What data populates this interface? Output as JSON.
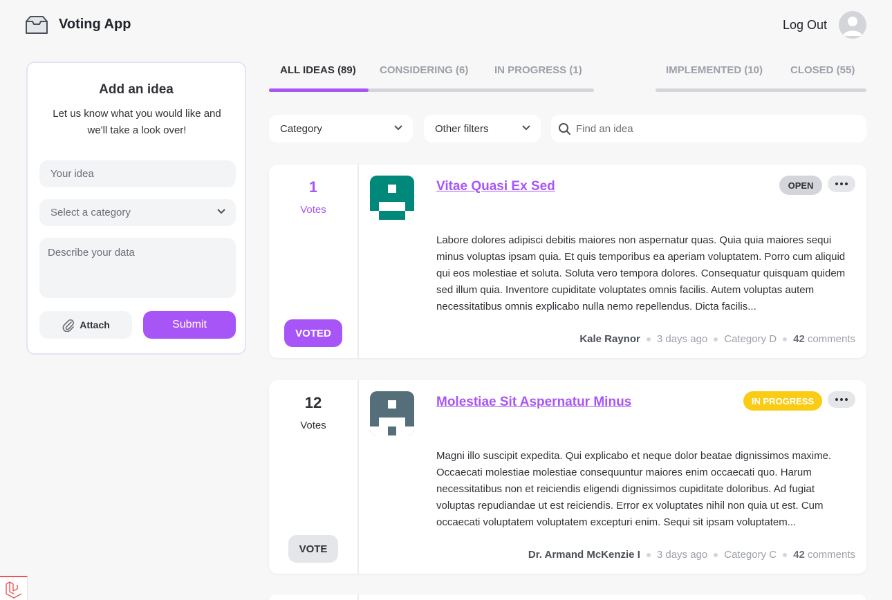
{
  "header": {
    "app_title": "Voting App",
    "logout_label": "Log Out",
    "logo_icon": "inbox-icon",
    "avatar_icon": "user-avatar-icon"
  },
  "add_idea": {
    "title": "Add an idea",
    "subtitle": "Let us know what you would like and we'll take a look over!",
    "idea_placeholder": "Your idea",
    "category_placeholder": "Select a category",
    "description_placeholder": "Describe your data",
    "attach_label": "Attach",
    "submit_label": "Submit"
  },
  "tabs": [
    {
      "label": "ALL IDEAS (89)",
      "active": true
    },
    {
      "label": "CONSIDERING (6)",
      "active": false
    },
    {
      "label": "IN PROGRESS (1)",
      "active": false
    },
    {
      "label": "IMPLEMENTED (10)",
      "active": false
    },
    {
      "label": "CLOSED (55)",
      "active": false
    }
  ],
  "filters": {
    "category_label": "Category",
    "other_label": "Other filters",
    "search_placeholder": "Find an idea"
  },
  "colors": {
    "accent": "#a855f7",
    "status_open": "#d4d5da",
    "status_in_progress": "#facc15"
  },
  "ideas": [
    {
      "votes": "1",
      "votes_label": "Votes",
      "voted": true,
      "vote_button": "VOTED",
      "title": "Vitae Quasi Ex Sed",
      "status": "OPEN",
      "description": "Labore dolores adipisci debitis maiores non aspernatur quas. Quia quia maiores sequi minus voluptas ipsam quia. Et quis temporibus ea aperiam voluptatem. Porro cum aliquid qui eos molestiae et soluta. Soluta vero tempora dolores. Consequatur quisquam quidem sed illum quia. Inventore cupiditate voluptates omnis facilis. Autem voluptas autem necessitatibus omnis explicabo nulla nemo repellendus. Dicta facilis...",
      "author": "Kale Raynor",
      "time": "3 days ago",
      "category": "Category D",
      "comments_count": "42",
      "comments_label": "comments",
      "avatar_color": "#00897b"
    },
    {
      "votes": "12",
      "votes_label": "Votes",
      "voted": false,
      "vote_button": "VOTE",
      "title": "Molestiae Sit Aspernatur Minus",
      "status": "IN PROGRESS",
      "description": "Magni illo suscipit expedita. Qui explicabo et neque dolor beatae dignissimos maxime. Occaecati molestiae molestiae consequuntur maiores enim occaecati quo. Harum necessitatibus non et reiciendis eligendi dignissimos cupiditate doloribus. Ad fugiat voluptas repudiandae ut est reiciendis. Error ex voluptates nihil non quia ut est. Cum occaecati voluptatem voluptatem excepturi enim. Sequi sit ipsam voluptatem...",
      "author": "Dr. Armand McKenzie I",
      "time": "3 days ago",
      "category": "Category C",
      "comments_count": "42",
      "comments_label": "comments",
      "avatar_color": "#546e7a"
    }
  ]
}
